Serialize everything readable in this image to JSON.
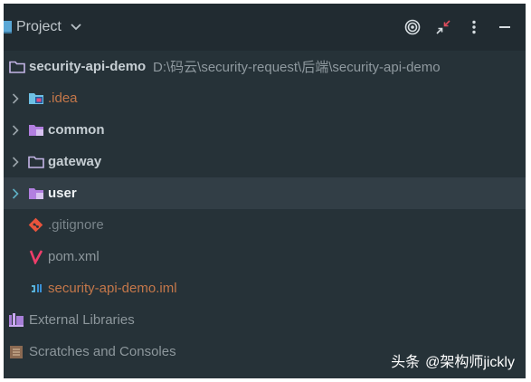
{
  "toolbar": {
    "project_label": "Project",
    "icons": {
      "project": "project-window-icon",
      "dropdown": "chevron-down-icon",
      "locate": "target-icon",
      "collapse": "collapse-arrows-icon",
      "options": "kebab-menu-icon",
      "hide": "minimize-icon"
    }
  },
  "tree": {
    "root": {
      "name": "security-api-demo",
      "path": "D:\\码云\\security-request\\后端\\security-api-demo"
    },
    "items": [
      {
        "name": ".idea",
        "kind": "folder-idea",
        "expandable": true
      },
      {
        "name": "common",
        "kind": "module-folder",
        "expandable": true
      },
      {
        "name": "gateway",
        "kind": "folder",
        "expandable": true
      },
      {
        "name": "user",
        "kind": "module-folder",
        "expandable": true,
        "selected": true
      },
      {
        "name": ".gitignore",
        "kind": "git-file",
        "expandable": false
      },
      {
        "name": "pom.xml",
        "kind": "maven-file",
        "expandable": false
      },
      {
        "name": "security-api-demo.iml",
        "kind": "iml-file",
        "expandable": false
      }
    ],
    "external_libraries": "External Libraries",
    "scratches": "Scratches and Consoles"
  },
  "watermark": {
    "source": "头条",
    "handle": "@架构师jickly"
  },
  "colors": {
    "panel_bg": "#263238",
    "toolbar_bg": "#212b31",
    "selection": "#323e46",
    "module_purple": "#b27fe0",
    "folder_blue": "#6ec0e4",
    "untracked_orange": "#c4774a"
  }
}
